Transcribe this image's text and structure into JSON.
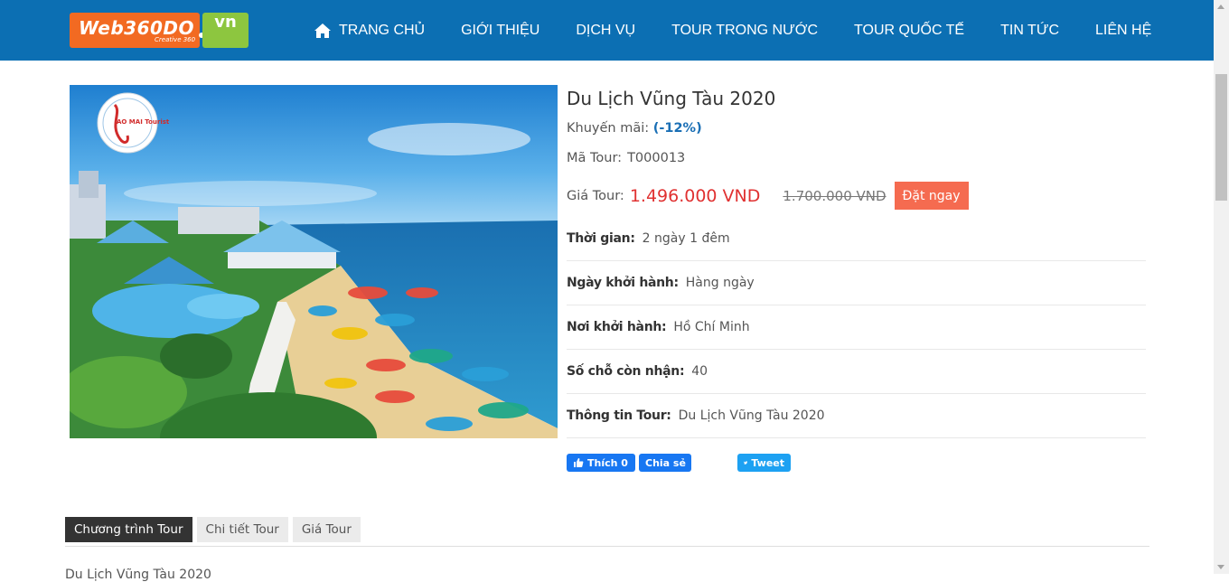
{
  "header": {
    "logo": {
      "brand": "Web360DO",
      "tagline": "Creative 360",
      "tld": "vn"
    },
    "nav": [
      {
        "label": "TRANG CHỦ",
        "icon": "home-icon"
      },
      {
        "label": "GIỚI THIỆU"
      },
      {
        "label": "DỊCH VỤ"
      },
      {
        "label": "TOUR TRONG NƯỚC"
      },
      {
        "label": "TOUR QUỐC TẾ"
      },
      {
        "label": "TIN TỨC"
      },
      {
        "label": "LIÊN HỆ"
      }
    ]
  },
  "tour": {
    "image": {
      "watermark": "AO MAI Tourist"
    },
    "title": "Du Lịch Vũng Tàu 2020",
    "promo_label": "Khuyến mãi:",
    "promo_value": "(-12%)",
    "code_label": "Mã Tour:",
    "code_value": "T000013",
    "price_label": "Giá Tour:",
    "price_new": "1.496.000 VND",
    "price_old": "1.700.000 VND",
    "book_label": "Đặt ngay",
    "details": [
      {
        "label": "Thời gian:",
        "value": "2 ngày 1 đêm"
      },
      {
        "label": "Ngày khởi hành:",
        "value": "Hàng ngày"
      },
      {
        "label": "Nơi khởi hành:",
        "value": "Hồ Chí Minh"
      },
      {
        "label": "Số chỗ còn nhận:",
        "value": "40"
      },
      {
        "label": "Thông tin Tour:",
        "value": "Du Lịch Vũng Tàu 2020"
      }
    ]
  },
  "social": {
    "like_label": "Thích 0",
    "share_label": "Chia sẻ",
    "tweet_label": "Tweet"
  },
  "tabs": [
    {
      "label": "Chương trình Tour",
      "active": true
    },
    {
      "label": "Chi tiết Tour",
      "active": false
    },
    {
      "label": "Giá Tour",
      "active": false
    }
  ],
  "below_text": "Du Lịch Vũng Tàu 2020",
  "colors": {
    "header": "#0c6fb3",
    "price": "#e03131",
    "book_button": "#f56b50",
    "promo": "#1a6fb5",
    "facebook": "#1877f2",
    "twitter": "#1da1f2"
  }
}
